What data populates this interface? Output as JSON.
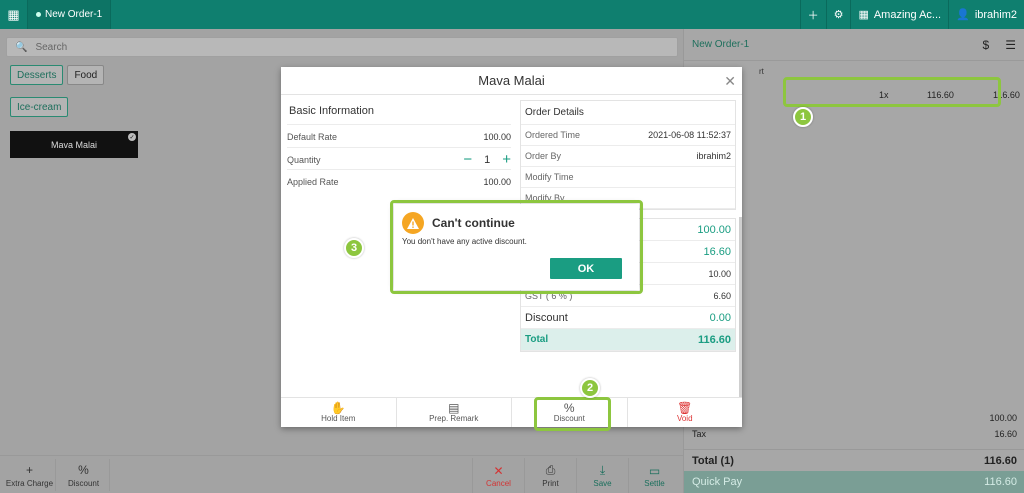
{
  "topbar": {
    "tab_label": "New Order-1",
    "store_name": "Amazing Ac...",
    "user_name": "ibrahim2"
  },
  "left": {
    "search_placeholder": "Search",
    "categories": [
      "Desserts",
      "Food"
    ],
    "subcategory": "Ice-cream",
    "item_name": "Mava Malai",
    "bottom_buttons": [
      {
        "label": "Extra Charge",
        "icon": "+"
      },
      {
        "label": "Discount",
        "icon": "%"
      }
    ]
  },
  "bottom_actions": [
    {
      "label": "Cancel",
      "icon": "✕",
      "color": "#d33333"
    },
    {
      "label": "Print",
      "icon": "⎙",
      "color": "#333333"
    },
    {
      "label": "Save",
      "icon": "⤓",
      "color": "#1a9d82"
    },
    {
      "label": "Settle",
      "icon": "▭",
      "color": "#1a9d82"
    }
  ],
  "right": {
    "order_title": "New Order-1",
    "partial_label": "rt",
    "line": {
      "qty": "1x",
      "rate": "116.60",
      "amount": "116.60"
    },
    "subtotal_value": "100.00",
    "tax_label": "Tax",
    "tax_value": "16.60",
    "total_label": "Total  (1)",
    "total_value": "116.60",
    "quickpay_label": "Quick Pay",
    "quickpay_value": "116.60"
  },
  "modal": {
    "title": "Mava Malai",
    "basic_title": "Basic Information",
    "default_rate_label": "Default Rate",
    "default_rate_value": "100.00",
    "quantity_label": "Quantity",
    "quantity_value": "1",
    "applied_rate_label": "Applied Rate",
    "applied_rate_value": "100.00",
    "order_details_title": "Order Details",
    "ordered_time_label": "Ordered Time",
    "ordered_time_value": "2021-06-08 11:52:37",
    "order_by_label": "Order By",
    "order_by_value": "ibrahim2",
    "modify_time_label": "Modify Time",
    "modify_by_label": "Modify By",
    "totals": {
      "v1": "100.00",
      "v2": "16.60",
      "v3": "10.00",
      "gst_label": "GST ( 6 % )",
      "gst_value": "6.60",
      "discount_label": "Discount",
      "discount_value": "0.00",
      "total_label": "Total",
      "total_value": "116.60"
    },
    "actions": [
      {
        "label": "Hold Item",
        "icon": "✋"
      },
      {
        "label": "Prep. Remark",
        "icon": "▤"
      },
      {
        "label": "Discount",
        "icon": "%"
      },
      {
        "label": "Void",
        "icon": "🗑"
      }
    ]
  },
  "alert": {
    "title": "Can't continue",
    "message": "You don't have any active discount.",
    "ok_label": "OK"
  },
  "annotations": [
    "1",
    "2",
    "3"
  ],
  "colors": {
    "accent": "#1a9d82",
    "topbar": "#0f7f6f",
    "highlight": "#8dc63f",
    "warning": "#f5a623"
  }
}
